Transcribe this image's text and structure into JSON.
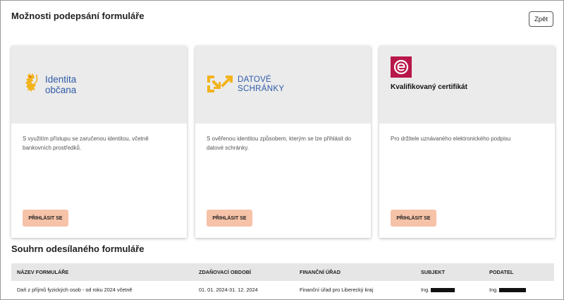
{
  "header": {
    "title": "Možnosti podepsání formuláře",
    "back_label": "Zpět"
  },
  "cards": [
    {
      "logo_text_line1": "Identita",
      "logo_text_line2": "občana",
      "description": "S využitím přístupu se zaručenou identitou, včetně bankovních prostředků.",
      "button_label": "PŘIHLÁSIT SE"
    },
    {
      "logo_text_line1": "DATOVÉ",
      "logo_text_line2": "SCHRÁNKY",
      "description": "S ověřenou identitou způsobem, kterým se lze přihlásit do datové schránky.",
      "button_label": "PŘIHLÁSIT SE"
    },
    {
      "title": "Kvalifikovaný certifikát",
      "description": "Pro držitele uznávaného elektronického podpisu",
      "button_label": "PŘIHLÁSIT SE"
    }
  ],
  "summary": {
    "title": "Souhrn odesílaného formuláře",
    "columns": [
      "NÁZEV FORMULÁŘE",
      "ZDAŇOVACÍ OBDOBÍ",
      "FINANČNÍ ÚŘAD",
      "SUBJEKT",
      "PODATEL"
    ],
    "rows": [
      {
        "name": "Daň z příjmů fyzických osob - od roku 2024 včetně",
        "period": "01. 01. 2024-31. 12. 2024",
        "office": "Finanční úřad pro Liberecký kraj",
        "subject_prefix": "Ing.",
        "filer_prefix": "Ing."
      }
    ]
  },
  "colors": {
    "button_bg": "#f6c2a8",
    "card_head_bg": "#ebebeb",
    "logo_blue": "#2f5aa8",
    "logo_gold": "#f2b31d",
    "eid_red": "#b8174a"
  },
  "icons": [
    "lion-icon",
    "datove-schranky-icon",
    "eidentita-icon"
  ]
}
